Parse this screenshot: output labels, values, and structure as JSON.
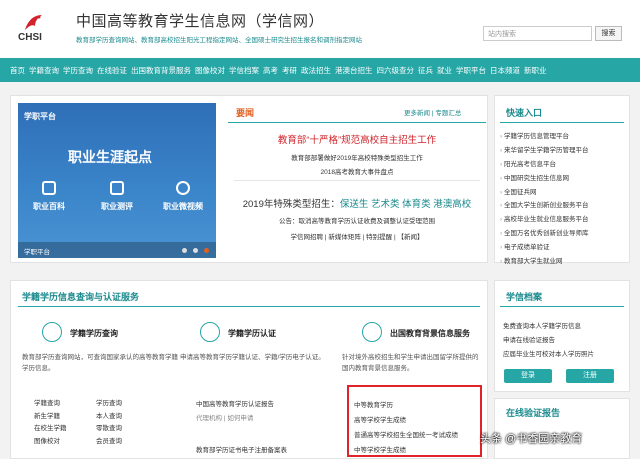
{
  "header": {
    "logo_text": "CHSI",
    "title": "中国高等教育学生信息网（学信网）",
    "subtitle": "教育部学历查询网站、教育部高校招生阳光工程指定网站、全国硕士研究生招生报名和调剂指定网站",
    "search_placeholder": "站内搜索",
    "search_button": "搜索"
  },
  "nav": [
    "首页",
    "学籍查询",
    "学历查询",
    "在线验证",
    "出国教育背景服务",
    "图像校对",
    "学信档案",
    "高考",
    "考研",
    "政法招生",
    "港澳台招生",
    "四六级查分",
    "征兵",
    "就业",
    "学职平台",
    "日本频道",
    "新职业"
  ],
  "carousel": {
    "brand": "学职平台",
    "title": "职业生涯起点",
    "items": [
      "职业百科",
      "职业测评",
      "职业微视频"
    ],
    "footer": "学职平台"
  },
  "news": {
    "heading": "要闻",
    "more": "更多新闻",
    "special": "专题汇总",
    "headline1": "教育部“十严格”规范高校自主招生工作",
    "sub1": "教育部部署做好2019年高校特殊类型招生工作",
    "sub2": "2018高考教育大事件盘点",
    "headline2_a": "2019年特殊类型招生：",
    "headline2_b": "保送生 艺术类 体育类 港澳高校",
    "notice": "公告：取消高等教育学历认证收费及调整认证受理范围",
    "links": "学信网招聘 | 新媒体矩阵 | 特别提醒 | 【新闻】"
  },
  "quick": {
    "heading": "快速入口",
    "items": [
      "学籍学历信息管理平台",
      "来华留学生学籍学历管理平台",
      "阳光高考信息平台",
      "中国研究生招生信息网",
      "全国征兵网",
      "全国大学生创新创业服务平台",
      "高校毕业生就业信息服务平台",
      "全国万名优秀创新创业导师库",
      "电子成绩单验证",
      "教育部大学生就业网"
    ]
  },
  "section": {
    "title": "学籍学历信息查询与认证服务",
    "col1": {
      "title": "学籍学历查询",
      "desc": "教育部学历查询网站，可查询国家承认的高等教育学籍学历信息。",
      "links": [
        "学籍查询",
        "学历查询",
        "新生学籍",
        "本人查询",
        "在校生学籍",
        "零散查询",
        "图像校对",
        "会员查询"
      ]
    },
    "col2": {
      "title": "学籍学历认证",
      "desc": "申请高等教育学历学籍认证、学籍/学历电子认证。",
      "link1": "中国高等教育学历认证报告",
      "link2": "代理机构",
      "link3": "如何申请",
      "link4": "教育部学历证书电子注册备案表"
    },
    "col3": {
      "title": "出国教育背景信息服务",
      "desc": "针对境外高校招生和学生申请出国留学所提供的国内教育背景信息服务。",
      "items": [
        "中等教育学历",
        "高等学校学生成绩",
        "普通高等学校招生全国统一考试成绩",
        "中等学校学生成绩"
      ]
    }
  },
  "archive": {
    "heading": "学信档案",
    "lines": [
      "免费查询本人学籍学历信息",
      "申请在线验证报告",
      "应届毕业生可校对本人学历照片"
    ],
    "login": "登录",
    "register": "注册",
    "verify_heading": "在线验证报告"
  },
  "watermark": "头条 @书香园亲教育"
}
